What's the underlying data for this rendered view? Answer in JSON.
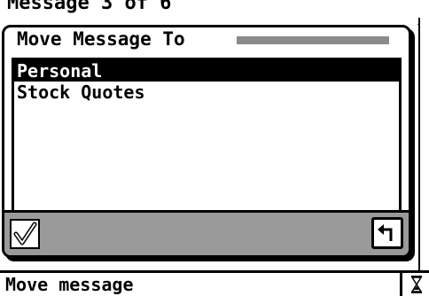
{
  "background_window": {
    "title": "Message 3 of 6",
    "nav_glyphs": "◄►"
  },
  "dialog": {
    "title": "Move Message To",
    "items": [
      {
        "label": "Personal",
        "selected": true
      },
      {
        "label": "Stock Quotes",
        "selected": false
      }
    ],
    "ok_icon": "checkmark-icon",
    "back_icon": "return-arrow-icon"
  },
  "status_bar": {
    "text": "Move message",
    "icon": "hourglass-icon"
  },
  "colors": {
    "ink": "#000000",
    "paper": "#ffffff",
    "button_bar": "#9a9a9a",
    "title_stripe": "#8a8a8a"
  }
}
